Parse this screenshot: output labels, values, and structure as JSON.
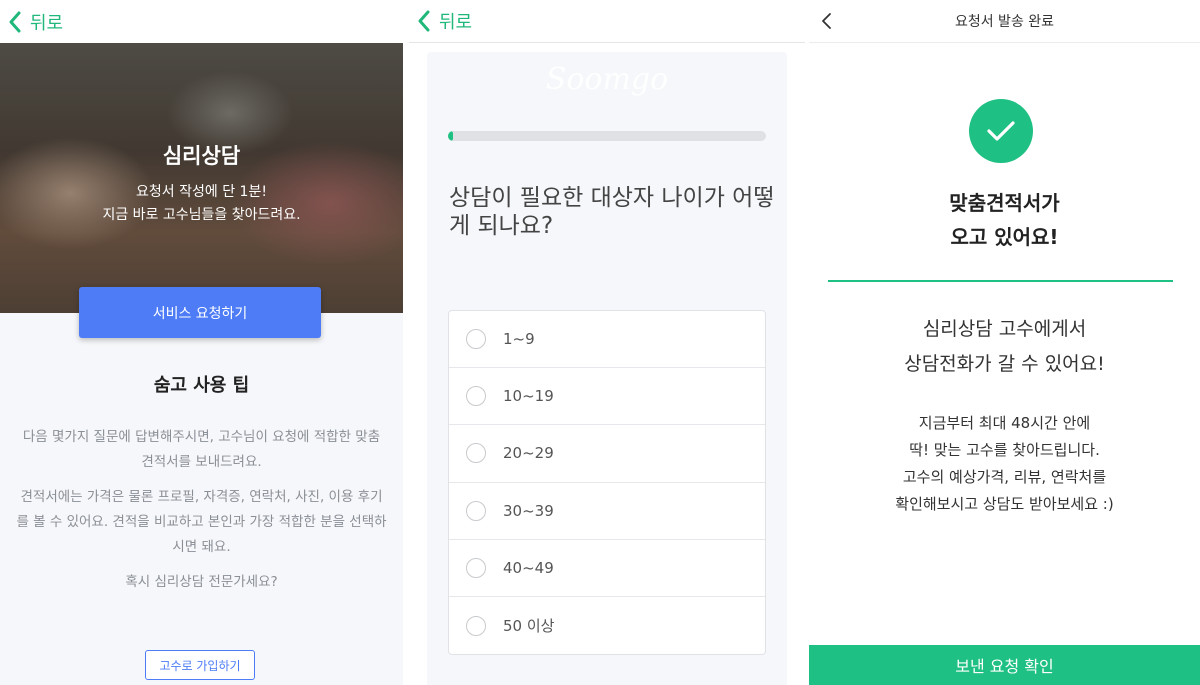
{
  "colors": {
    "accent_green": "#1fc083",
    "accent_blue": "#4d7cf6",
    "muted_text": "#8a8f96"
  },
  "panel1": {
    "back_label": "뒤로",
    "hero_title": "심리상담",
    "hero_line1": "요청서 작성에 단 1분!",
    "hero_line2": "지금 바로 고수님들을 찾아드려요.",
    "request_button": "서비스 요청하기",
    "tips_title": "숨고 사용 팁",
    "tip1": "다음 몇가지 질문에 답변해주시면, 고수님이 요청에 적합한 맞춤 견적서를 보내드려요.",
    "tip2": "견적서에는 가격은 물론 프로필, 자격증, 연락처, 사진, 이용 후기를 볼 수 있어요. 견적을 비교하고 본인과 가장 적합한 분을 선택하시면 돼요.",
    "tip3": "혹시 심리상담 전문가세요?",
    "join_button": "고수로 가입하기"
  },
  "panel2": {
    "back_label": "뒤로",
    "watermark": "Soomgo",
    "progress_fraction": 0.01,
    "question": "상담이 필요한 대상자 나이가 어떻게 되나요?",
    "options": [
      "1~9",
      "10~19",
      "20~29",
      "30~39",
      "40~49",
      "50 이상"
    ]
  },
  "panel3": {
    "nav_title": "요청서 발송 완료",
    "done_line1": "맞춤견적서가",
    "done_line2": "오고 있어요!",
    "sub_line1": "심리상담 고수에게서",
    "sub_line2": "상담전화가 갈 수 있어요!",
    "desc_line1": "지금부터 최대 48시간 안에",
    "desc_line2": "딱! 맞는 고수를 찾아드립니다.",
    "desc_line3": "고수의 예상가격, 리뷰, 연락처를",
    "desc_line4": "확인해보시고 상담도 받아보세요 :)",
    "confirm_button": "보낸 요청 확인"
  }
}
